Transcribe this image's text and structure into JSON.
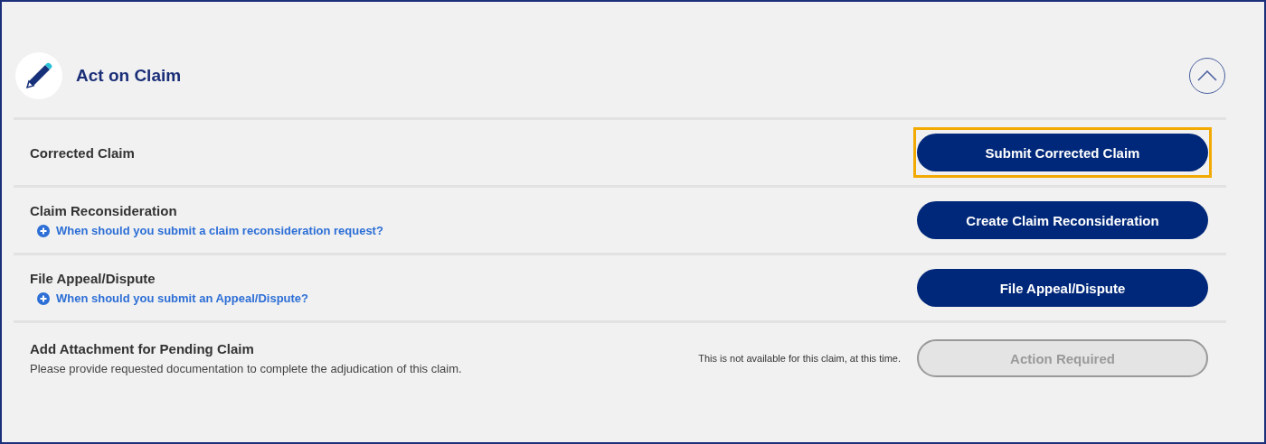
{
  "panel": {
    "title": "Act on Claim",
    "expanded": true
  },
  "rows": [
    {
      "title": "Corrected Claim",
      "button": {
        "label": "Submit Corrected Claim",
        "disabled": false,
        "highlighted": true
      }
    },
    {
      "title": "Claim Reconsideration",
      "link": "When should you submit a claim reconsideration request?",
      "button": {
        "label": "Create Claim Reconsideration",
        "disabled": false,
        "highlighted": false
      }
    },
    {
      "title": "File Appeal/Dispute",
      "link": "When should you submit an Appeal/Dispute?",
      "button": {
        "label": "File Appeal/Dispute",
        "disabled": false,
        "highlighted": false
      }
    },
    {
      "title": "Add Attachment for Pending Claim",
      "description": "Please provide requested documentation to complete the adjudication of this claim.",
      "note": "This is not available for this claim, at this time.",
      "button": {
        "label": "Action Required",
        "disabled": true,
        "highlighted": false
      }
    }
  ]
}
